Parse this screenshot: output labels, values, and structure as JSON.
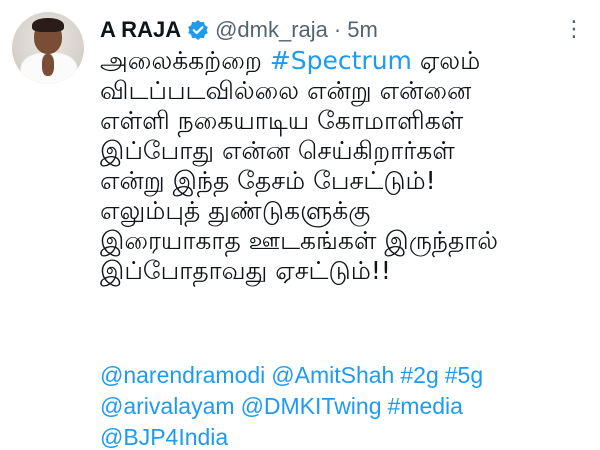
{
  "tweet": {
    "author": {
      "name": "A RAJA",
      "handle": "@dmk_raja",
      "separator": "·",
      "time": "5m",
      "verified_color": "#1d9bf0"
    },
    "more_icon": "⋮",
    "text_lines": [
      {
        "pre": "அலைக்கற்றை ",
        "link": "#Spectrum",
        "post": " ஏலம்"
      },
      {
        "pre": "விடப்படவில்லை என்று என்னை",
        "link": "",
        "post": ""
      },
      {
        "pre": "எள்ளி நகையாடிய கோமாளிகள்",
        "link": "",
        "post": ""
      },
      {
        "pre": "இப்போது என்ன செய்கிறார்கள்",
        "link": "",
        "post": ""
      },
      {
        "pre": "என்று இந்த தேசம் பேசட்டும்!",
        "link": "",
        "post": ""
      },
      {
        "pre": "எலும்புத் துண்டுகளுக்கு",
        "link": "",
        "post": ""
      },
      {
        "pre": "இரையாகாத ஊடகங்கள் இருந்தால்",
        "link": "",
        "post": ""
      },
      {
        "pre": "இப்போதாவது ஏசட்டும்!!",
        "link": "",
        "post": ""
      }
    ],
    "tags_lines": [
      [
        "@narendramodi",
        "@AmitShah",
        "#2g",
        "#5g"
      ],
      [
        "@arivalayam",
        "@DMKITwing",
        "#media"
      ],
      [
        "@BJP4India"
      ]
    ],
    "colors": {
      "text": "#0f1419",
      "secondary": "#536471",
      "link": "#1d9bf0",
      "background": "#ffffff"
    }
  }
}
